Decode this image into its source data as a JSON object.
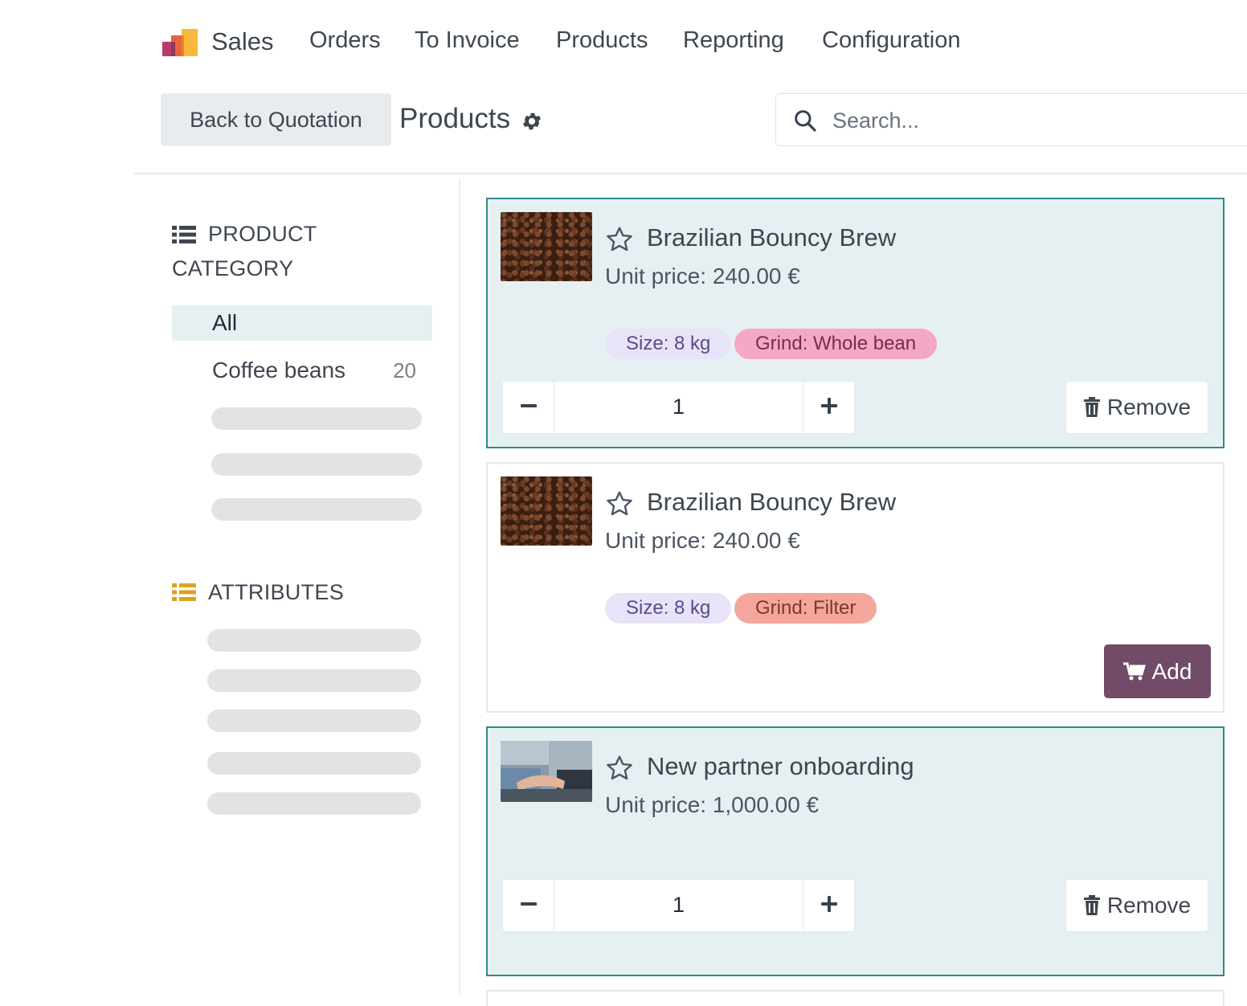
{
  "nav": {
    "app_name": "Sales",
    "items": [
      "Orders",
      "To Invoice",
      "Products",
      "Reporting",
      "Configuration"
    ]
  },
  "controls": {
    "back_label": "Back to Quotation",
    "title": "Products",
    "search_placeholder": "Search..."
  },
  "sidebar": {
    "category_heading_line1": "PRODUCT",
    "category_heading_line2": "CATEGORY",
    "categories": [
      {
        "label": "All",
        "selected": true
      },
      {
        "label": "Coffee beans",
        "count": "20"
      }
    ],
    "attributes_heading": "ATTRIBUTES"
  },
  "products": [
    {
      "name": "Brazilian Bouncy Brew",
      "price": "Unit price: 240.00 €",
      "tags": [
        "Size: 8 kg",
        "Grind: Whole bean"
      ],
      "quantity": "1",
      "action": "Remove",
      "image": "coffee-beans"
    },
    {
      "name": "Brazilian Bouncy Brew",
      "price": "Unit price: 240.00 €",
      "tags": [
        "Size: 8 kg",
        "Grind: Filter"
      ],
      "action": "Add",
      "image": "coffee-beans"
    },
    {
      "name": "New partner onboarding",
      "price": "Unit price: 1,000.00 €",
      "quantity": "1",
      "action": "Remove",
      "image": "handshake"
    }
  ],
  "colors": {
    "accent": "#714b67",
    "selected_border": "#2e8b8c",
    "selected_bg": "#e6f0f2",
    "tag_size": "#e8e3f8",
    "tag_whole_bean": "#f4a7c7",
    "tag_filter": "#f4a69d"
  },
  "icons": [
    "sales-logo-icon",
    "gear-icon",
    "search-icon",
    "list-icon",
    "star-icon",
    "minus-icon",
    "plus-icon",
    "trash-icon",
    "cart-icon"
  ]
}
